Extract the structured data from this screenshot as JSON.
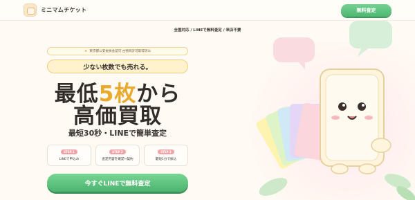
{
  "header": {
    "logo_text": "ミニマムチケット",
    "cta_label": "無料査定"
  },
  "subnav": {
    "text": "全国対応 / LINEで無料査定 / 来店不要"
  },
  "hero": {
    "badge_text": "東京都公安委員会認可 古物商許可取得済み",
    "tagline": "少ない枚数でも売れる。",
    "headline_line1_pre": "最低",
    "headline_line1_accent": "5枚",
    "headline_line1_post": "から",
    "headline_line2": "高価買取",
    "subheadline": "最短30秒・LINEで簡単査定",
    "cta_label": "今すぐLINEで無料査定"
  },
  "steps": [
    {
      "pill": "STEP 1",
      "text": "LINEで申込み"
    },
    {
      "pill": "STEP 2",
      "text": "査定内容を確認→契約"
    },
    {
      "pill": "STEP 3",
      "text": "最短1分で振込"
    }
  ],
  "colors": {
    "accent": "#e8a92c",
    "brand_green": "#4fb873",
    "pill_pink": "#f2a3a8"
  },
  "icons": {
    "logo": "ticket-mascot-icon",
    "badge": "star-icon"
  }
}
